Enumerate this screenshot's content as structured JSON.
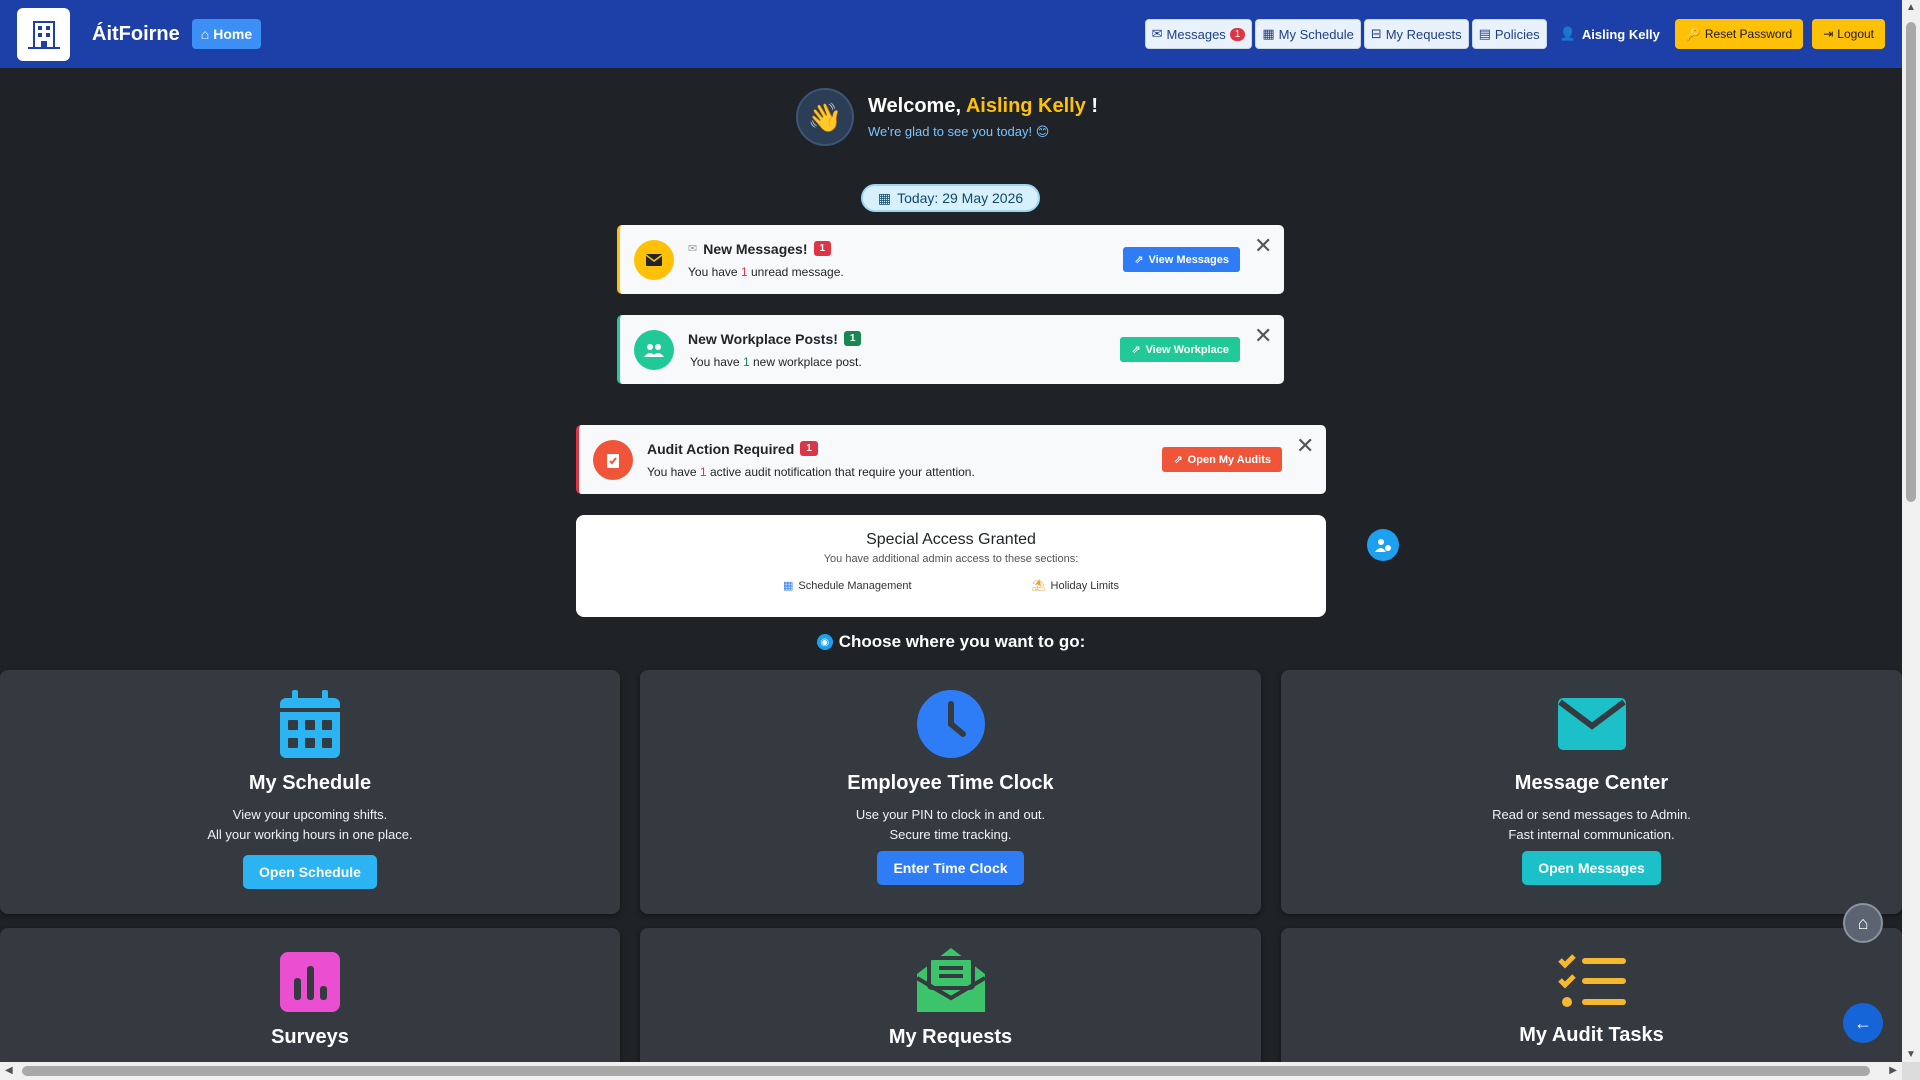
{
  "app": {
    "name": "ÁitFoirne"
  },
  "navbar": {
    "home_label": "Home",
    "messages_label": "Messages",
    "messages_count": "1",
    "schedule_label": "My Schedule",
    "requests_label": "My Requests",
    "policies_label": "Policies",
    "user_name": "Aisling Kelly",
    "reset_label": "Reset Password",
    "logout_label": "Logout"
  },
  "welcome": {
    "prefix": "Welcome,",
    "name": "Aisling Kelly",
    "suffix": "!",
    "subtitle": "We're glad to see you today! 😊"
  },
  "today": "Today: 29 May 2026",
  "notifications": {
    "messages": {
      "title": "New Messages!",
      "count": "1",
      "desc_pre": "You have",
      "desc_num": "1",
      "desc_post": "unread message.",
      "action": "View Messages"
    },
    "workplace": {
      "title": "New Workplace Posts!",
      "count": "1",
      "desc_pre": "You have",
      "desc_num": "1",
      "desc_post": "new workplace post.",
      "action": "View Workplace"
    },
    "audit": {
      "title": "Audit Action Required",
      "count": "1",
      "desc_pre": "You have",
      "desc_num": "1",
      "desc_post": "active audit notification that require your attention.",
      "action": "Open My Audits"
    }
  },
  "special_access": {
    "title": "Special Access Granted",
    "subtitle": "You have additional admin access to these sections:",
    "items": [
      "Schedule Management",
      "Holiday Limits"
    ]
  },
  "choose_label": "Choose where you want to go:",
  "tiles": [
    {
      "title": "My Schedule",
      "desc1": "View your upcoming shifts.",
      "desc2": "All your working hours in one place.",
      "button": "Open Schedule",
      "color": "#2bb3f2"
    },
    {
      "title": "Employee Time Clock",
      "desc1": "Use your PIN to clock in and out.",
      "desc2": "Secure time tracking.",
      "button": "Enter Time Clock",
      "color": "#2f7df6"
    },
    {
      "title": "Message Center",
      "desc1": "Read or send messages to Admin.",
      "desc2": "Fast internal communication.",
      "button": "Open Messages",
      "color": "#1cc0c8"
    },
    {
      "title": "Surveys"
    },
    {
      "title": "My Requests"
    },
    {
      "title": "My Audit Tasks"
    }
  ],
  "colors": {
    "navbar": "#1c3fa8",
    "warning": "#ffc107",
    "danger": "#dc3545",
    "success": "#20c997"
  }
}
